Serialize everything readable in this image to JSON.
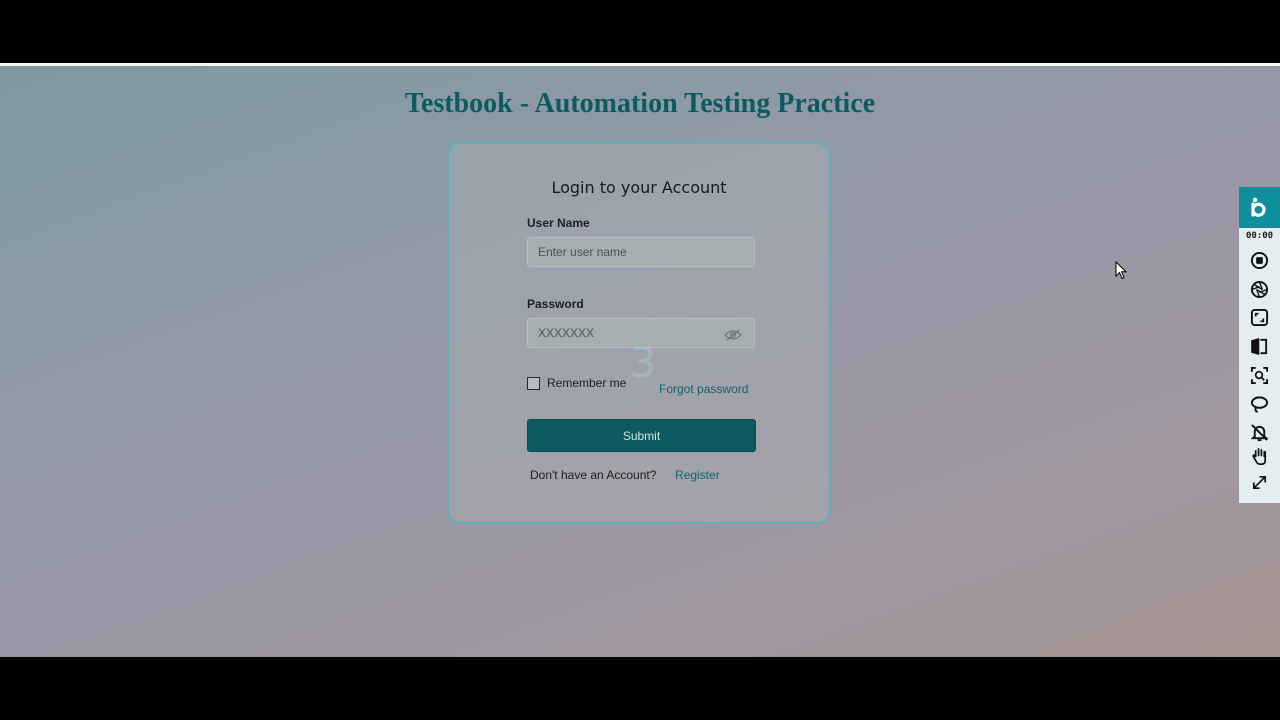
{
  "header": {
    "title": "Testbook - Automation Testing Practice"
  },
  "login": {
    "heading": "Login to your Account",
    "username_label": "User Name",
    "username_placeholder": "Enter user name",
    "username_value": "",
    "password_label": "Password",
    "password_placeholder": "XXXXXXX",
    "password_value": "",
    "remember_label": "Remember me",
    "remember_checked": false,
    "forgot_label": "Forgot password",
    "submit_label": "Submit",
    "no_account_text": "Don't have an Account?",
    "register_label": "Register"
  },
  "overlay": {
    "countdown": "3"
  },
  "recorder": {
    "timer": "00:00",
    "accent": "#0f8e9c",
    "tools": [
      "stop-icon",
      "aperture-icon",
      "capture-area-icon",
      "split-screen-icon",
      "zoom-focus-icon",
      "lasso-icon",
      "notifications-off-icon",
      "hand-icon",
      "expand-icon"
    ]
  },
  "colors": {
    "brand": "#0d5a60",
    "link": "#17616a",
    "card_border": "#5fb0b4"
  }
}
